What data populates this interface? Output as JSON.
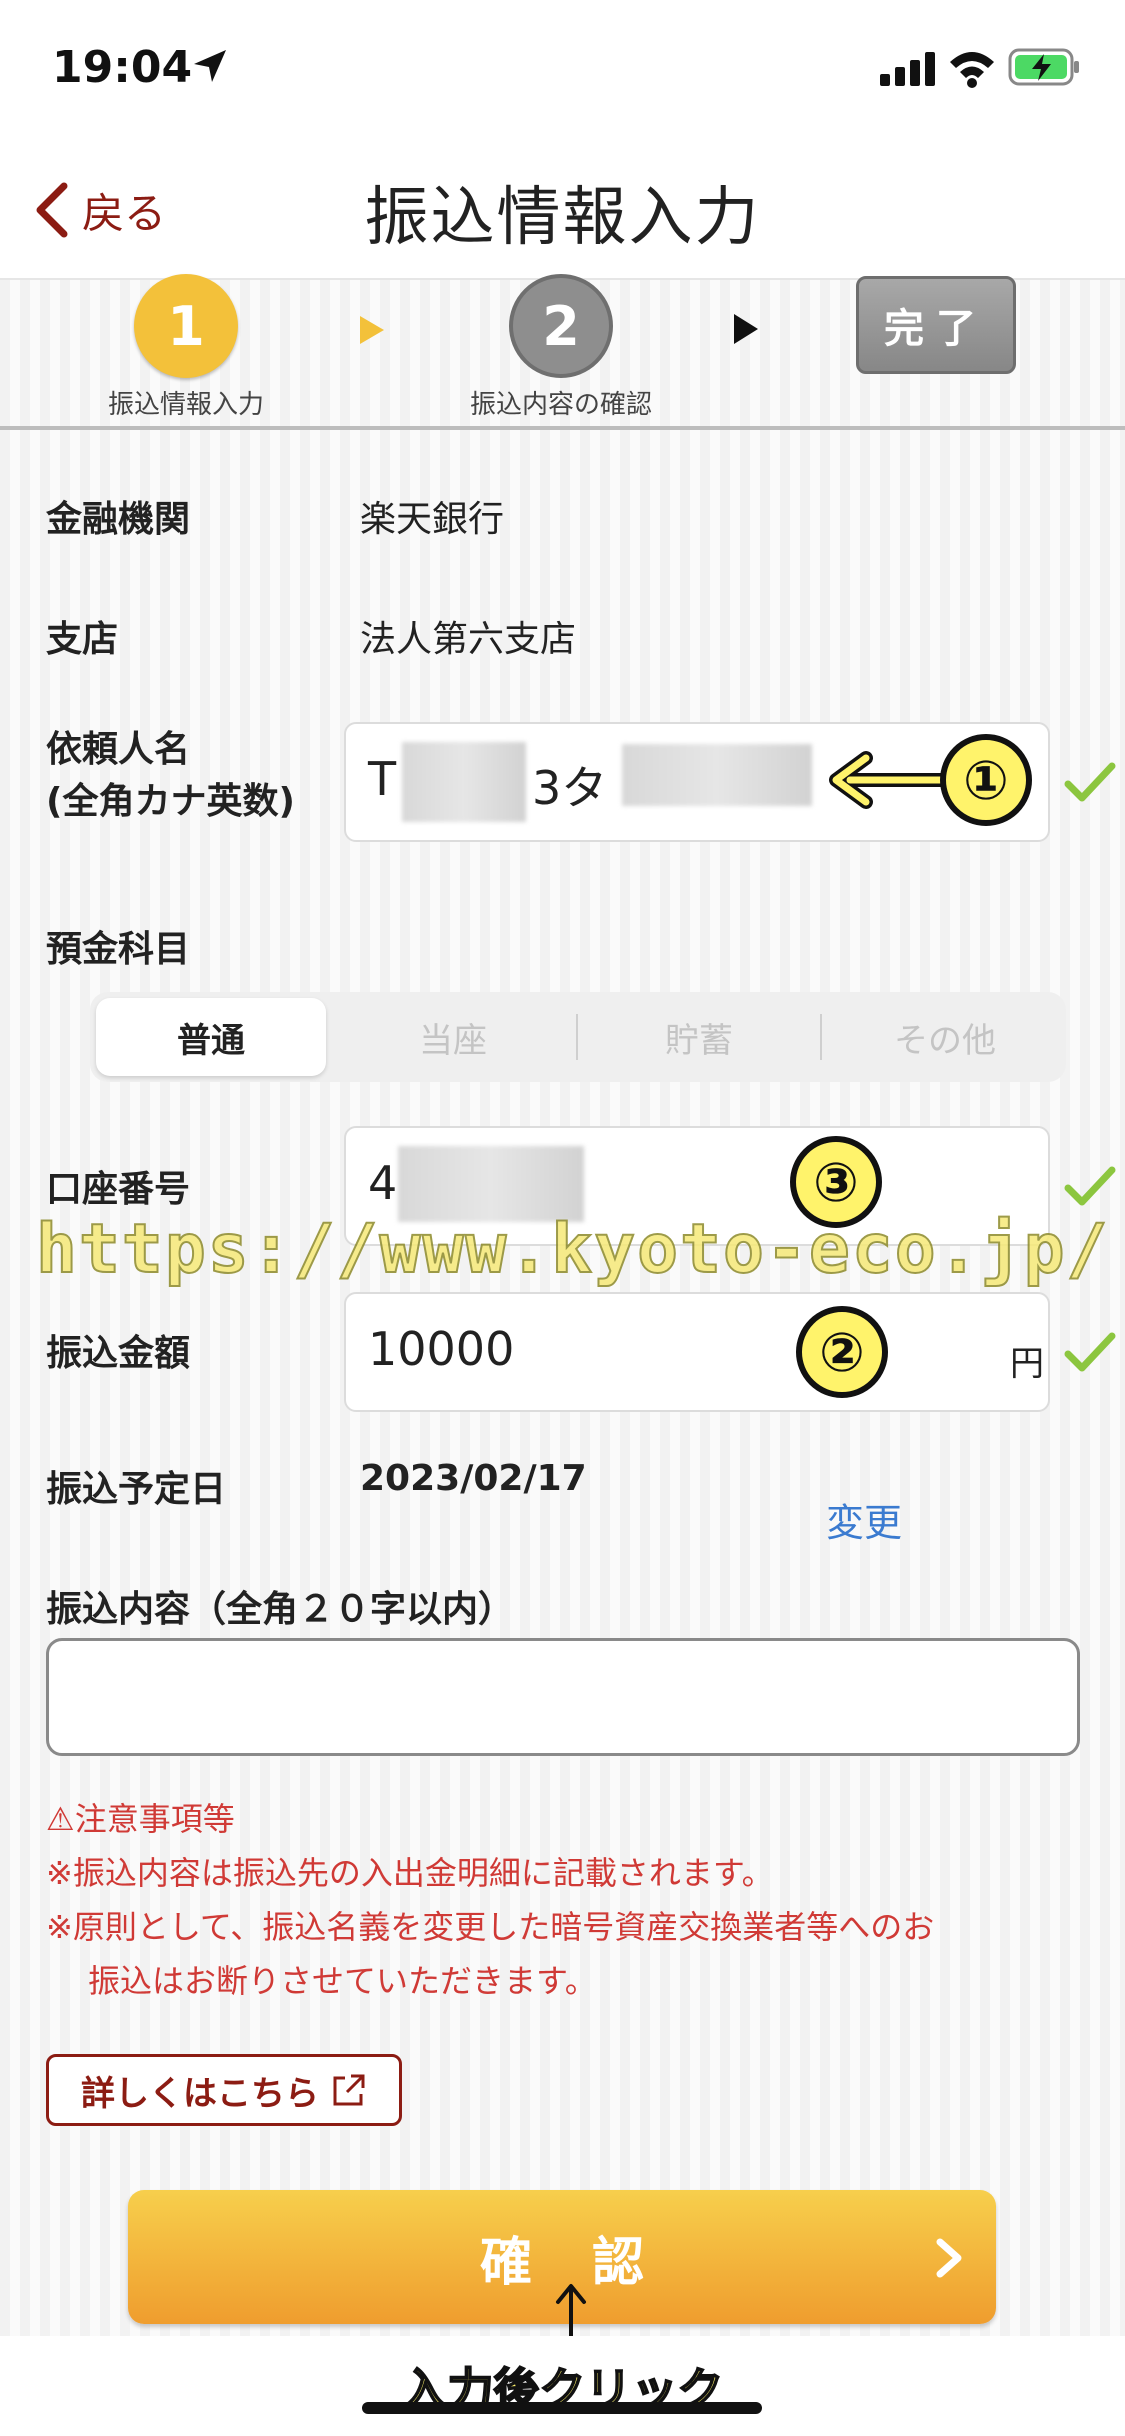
{
  "status": {
    "time": "19:04"
  },
  "nav": {
    "back_label": "戻る",
    "title": "振込情報入力"
  },
  "steps": [
    {
      "number": "1",
      "label": "振込情報入力",
      "state": "current"
    },
    {
      "number": "2",
      "label": "振込内容の確認",
      "state": "upcoming"
    },
    {
      "number": "",
      "label": "完了",
      "state": "upcoming"
    }
  ],
  "form": {
    "bank_label": "金融機関",
    "bank_value": "楽天銀行",
    "branch_label": "支店",
    "branch_value": "法人第六支店",
    "requester_label_1": "依頼人名",
    "requester_label_2": "(全角カナ英数)",
    "requester_value_a": "T",
    "requester_value_b": "3タ",
    "account_type_label": "預金科目",
    "account_types": [
      "普通",
      "当座",
      "貯蓄",
      "その他"
    ],
    "account_type_selected": "普通",
    "account_number_label": "口座番号",
    "account_number_value": "4",
    "amount_label": "振込金額",
    "amount_value": "10000",
    "amount_unit": "円",
    "date_label": "振込予定日",
    "date_value": "2023/02/17",
    "change_label": "変更",
    "memo_label": "振込内容（全角２０字以内）",
    "memo_value": ""
  },
  "notice": {
    "title": "⚠注意事項等",
    "line1": "※振込内容は振込先の入出金明細に記載されます。",
    "line2": "※原則として、振込名義を変更した暗号資産交換業者等へのお",
    "line3": "振込はお断りさせていただきます。"
  },
  "detail_button": "詳しくはこちら",
  "confirm_button": "確認",
  "annotations": {
    "marker_1": "①",
    "marker_2": "②",
    "marker_3": "③",
    "click_hint": "入力後クリック",
    "watermark": "https://www.kyoto-eco.jp/"
  },
  "colors": {
    "accent": "#8c1c13",
    "step_active": "#f3c13a",
    "check": "#8cc63f",
    "link": "#3b7bd0",
    "notice": "#d03a36"
  }
}
